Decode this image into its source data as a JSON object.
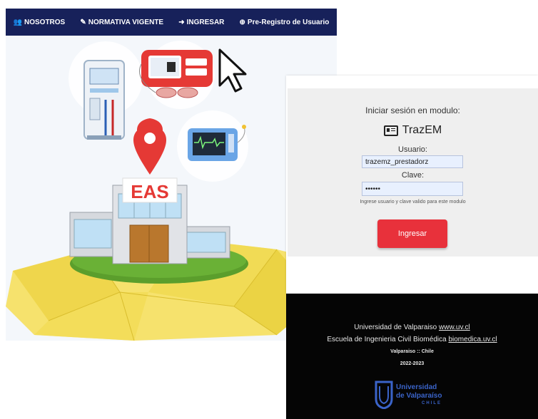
{
  "nav": {
    "items": [
      {
        "icon": "users-icon",
        "glyph": "👥",
        "label": "NOSOTROS"
      },
      {
        "icon": "pencil-icon",
        "glyph": "✎",
        "label": "NORMATIVA VIGENTE"
      },
      {
        "icon": "sign-in-icon",
        "glyph": "➜",
        "label": "INGRESAR"
      },
      {
        "icon": "plus-circle-icon",
        "glyph": "⊕",
        "label": "Pre-Registro de Usuario"
      }
    ]
  },
  "illustration": {
    "building_sign": "EAS"
  },
  "login": {
    "title": "Iniciar sesión en modulo:",
    "module_name": "TrazEM",
    "user_label": "Usuario:",
    "user_value": "trazemz_prestadorz",
    "password_label": "Clave:",
    "password_value": "••••••",
    "hint": "Ingrese usuario y clave valido para este modulo",
    "button_label": "Ingresar"
  },
  "footer": {
    "line1_text": "Universidad de Valparaiso ",
    "line1_link": "www.uv.cl",
    "line2_text": "Escuela de Ingenieria Civil Biomédica ",
    "line2_link": "biomedica.uv.cl",
    "location": "Valparaiso :: Chile",
    "years": "2022-2023",
    "logo_line1": "Universidad",
    "logo_line2": "de Valparaíso",
    "logo_line3": "CHILE"
  },
  "colors": {
    "nav_bg": "#17215a",
    "button": "#e8313b",
    "footer_bg": "#050505",
    "pin_red": "#e53935",
    "logo_blue": "#3a63c8"
  }
}
